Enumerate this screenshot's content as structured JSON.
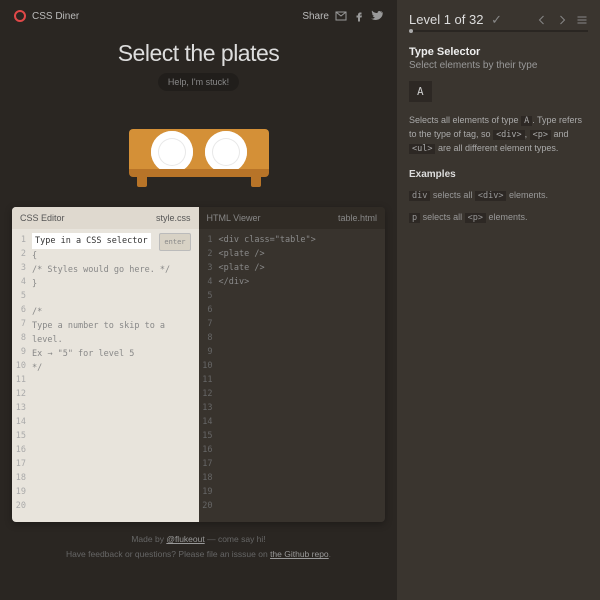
{
  "header": {
    "app_name": "CSS Diner",
    "share_label": "Share"
  },
  "hero": {
    "title": "Select the plates",
    "help_label": "Help, I'm stuck!"
  },
  "editors": {
    "css": {
      "title": "CSS Editor",
      "filename": "style.css",
      "input_placeholder": "Type in a CSS selector",
      "enter_label": "enter",
      "line2": "{",
      "line3": "/* Styles would go here. */",
      "line4": "}",
      "line6": "/*",
      "line7": "Type a number to skip to a",
      "line8": "level.",
      "line9": "Ex → \"5\" for level 5",
      "line10": "*/"
    },
    "html": {
      "title": "HTML Viewer",
      "filename": "table.html",
      "line1": "<div class=\"table\">",
      "line2": "  <plate />",
      "line3": "  <plate />",
      "line4": "</div>"
    },
    "line_count": 20
  },
  "footer": {
    "made_by_prefix": "Made by ",
    "made_by_link": "@flukeout",
    "made_by_suffix": " — come say hi!",
    "feedback_prefix": "Have feedback or questions? Please file an isssue on ",
    "feedback_link": "the Github repo",
    "feedback_suffix": "."
  },
  "sidebar": {
    "level_label": "Level 1 of 32",
    "checkmark": "✓",
    "selector_title": "Type Selector",
    "selector_subtitle": "Select elements by their type",
    "syntax": "A",
    "description_p1": "Selects all elements of type ",
    "description_tag_a": "A",
    "description_p2": ". Type refers to the type of tag, so ",
    "description_tag_div": "<div>",
    "description_p3": ", ",
    "description_tag_p": "<p>",
    "description_p4": " and ",
    "description_tag_ul": "<ul>",
    "description_p5": " are all different element types.",
    "examples_label": "Examples",
    "ex1_code": "div",
    "ex1_mid": " selects all ",
    "ex1_tag": "<div>",
    "ex1_end": " elements.",
    "ex2_code": "p",
    "ex2_mid": " selects all ",
    "ex2_tag": "<p>",
    "ex2_end": " elements."
  }
}
